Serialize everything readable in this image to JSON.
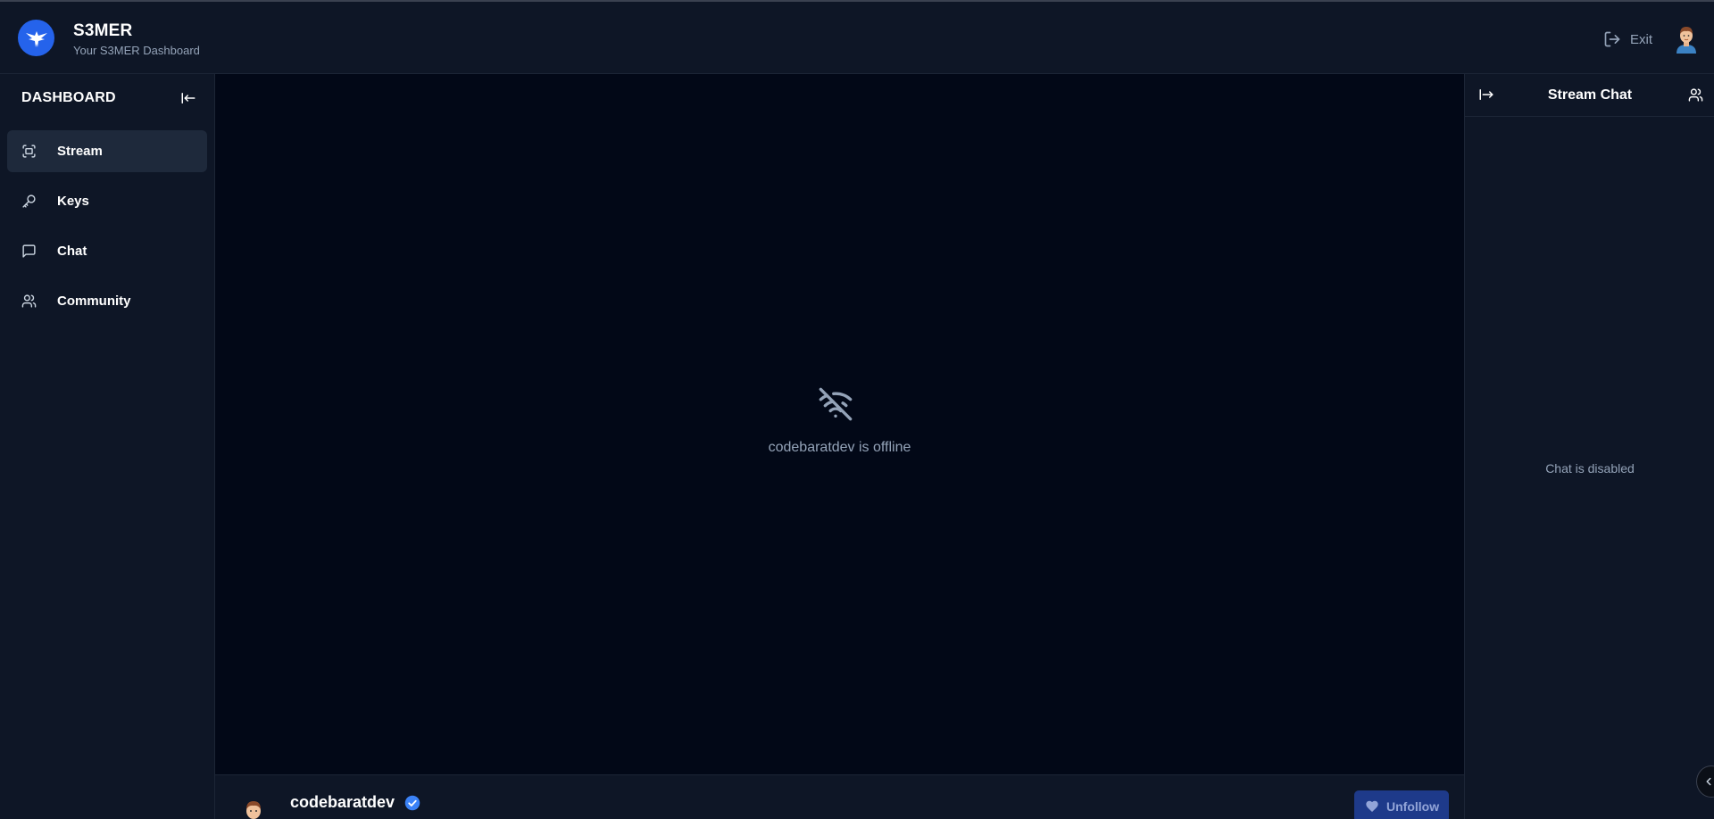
{
  "colors": {
    "accent": "#2563eb",
    "background": "#020817",
    "panel": "#0e1626",
    "active": "#1e293b",
    "muted": "#94a3b8",
    "verified": "#3b82f6"
  },
  "header": {
    "brand_title": "S3MER",
    "brand_subtitle": "Your S3MER Dashboard",
    "logo_icon": "eagle-logo-icon",
    "exit_label": "Exit",
    "exit_icon": "log-out-icon",
    "avatar_icon": "user-avatar"
  },
  "sidebar": {
    "heading": "DASHBOARD",
    "collapse_icon": "arrow-left-to-line-icon",
    "items": [
      {
        "label": "Stream",
        "icon": "scan-fullscreen-icon",
        "active": true
      },
      {
        "label": "Keys",
        "icon": "key-icon",
        "active": false
      },
      {
        "label": "Chat",
        "icon": "message-square-icon",
        "active": false
      },
      {
        "label": "Community",
        "icon": "users-icon",
        "active": false
      }
    ]
  },
  "player": {
    "offline_icon": "wifi-off-icon",
    "offline_text": "codebaratdev is offline"
  },
  "stream_info": {
    "username": "codebaratdev",
    "verified": true,
    "unfollow_label": "Unfollow",
    "unfollow_icon": "heart-icon"
  },
  "chat": {
    "title": "Stream Chat",
    "expand_icon": "arrow-right-from-line-icon",
    "community_icon": "users-icon",
    "status_text": "Chat is disabled"
  }
}
